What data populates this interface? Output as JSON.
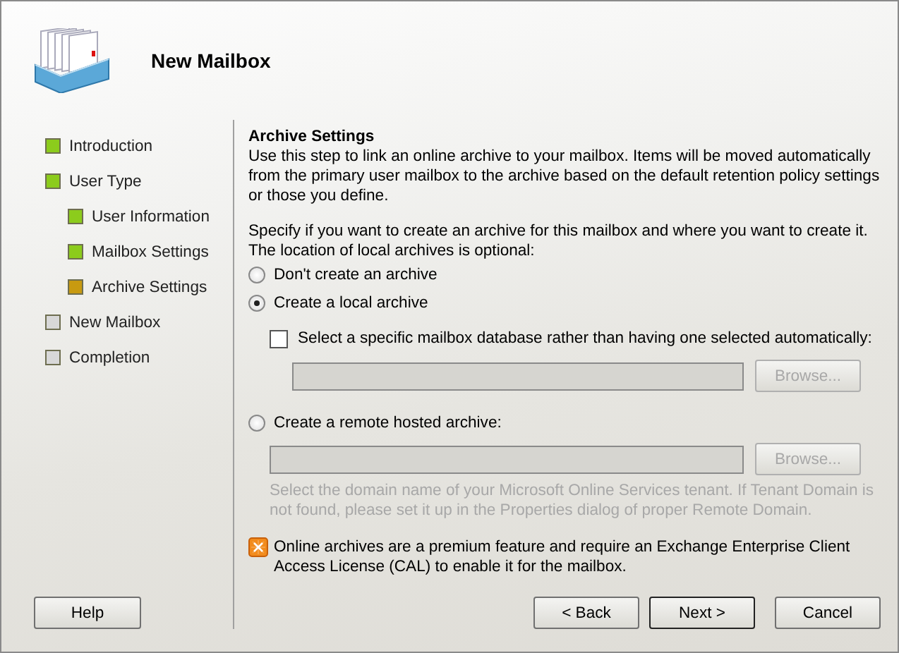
{
  "window": {
    "title": "New Mailbox"
  },
  "steps": [
    {
      "label": "Introduction",
      "kind": "done"
    },
    {
      "label": "User Type",
      "kind": "done",
      "children": [
        {
          "label": "User Information",
          "kind": "done"
        },
        {
          "label": "Mailbox Settings",
          "kind": "done"
        },
        {
          "label": "Archive Settings",
          "kind": "current"
        }
      ]
    },
    {
      "label": "New Mailbox",
      "kind": "pending"
    },
    {
      "label": "Completion",
      "kind": "pending"
    }
  ],
  "help_button": "Help",
  "section": {
    "title": "Archive Settings",
    "intro": "Use this step to link an online archive to your mailbox. Items will be moved automatically from the primary user mailbox to the archive based on the default retention policy settings or those you define.",
    "prompt": "Specify if you want to create an archive for this mailbox and where you want to create it. The location of local archives is optional:"
  },
  "options": [
    {
      "label": "Don't create an archive",
      "selected": false
    },
    {
      "label": "Create a local archive",
      "selected": true,
      "checkbox": {
        "label": "Select a specific mailbox database rather than having one selected automatically:",
        "checked": false
      },
      "browse": "Browse..."
    },
    {
      "label": "Create a remote hosted archive:",
      "selected": false,
      "browse": "Browse...",
      "hint": "Select the domain name of your Microsoft Online Services tenant. If Tenant Domain is not found, please set it up in the Properties dialog of proper Remote Domain."
    }
  ],
  "info": "Online archives are a premium feature and require an Exchange Enterprise Client Access License (CAL) to enable it for the mailbox.",
  "buttons": [
    "< Back",
    "Next >",
    "Cancel"
  ]
}
